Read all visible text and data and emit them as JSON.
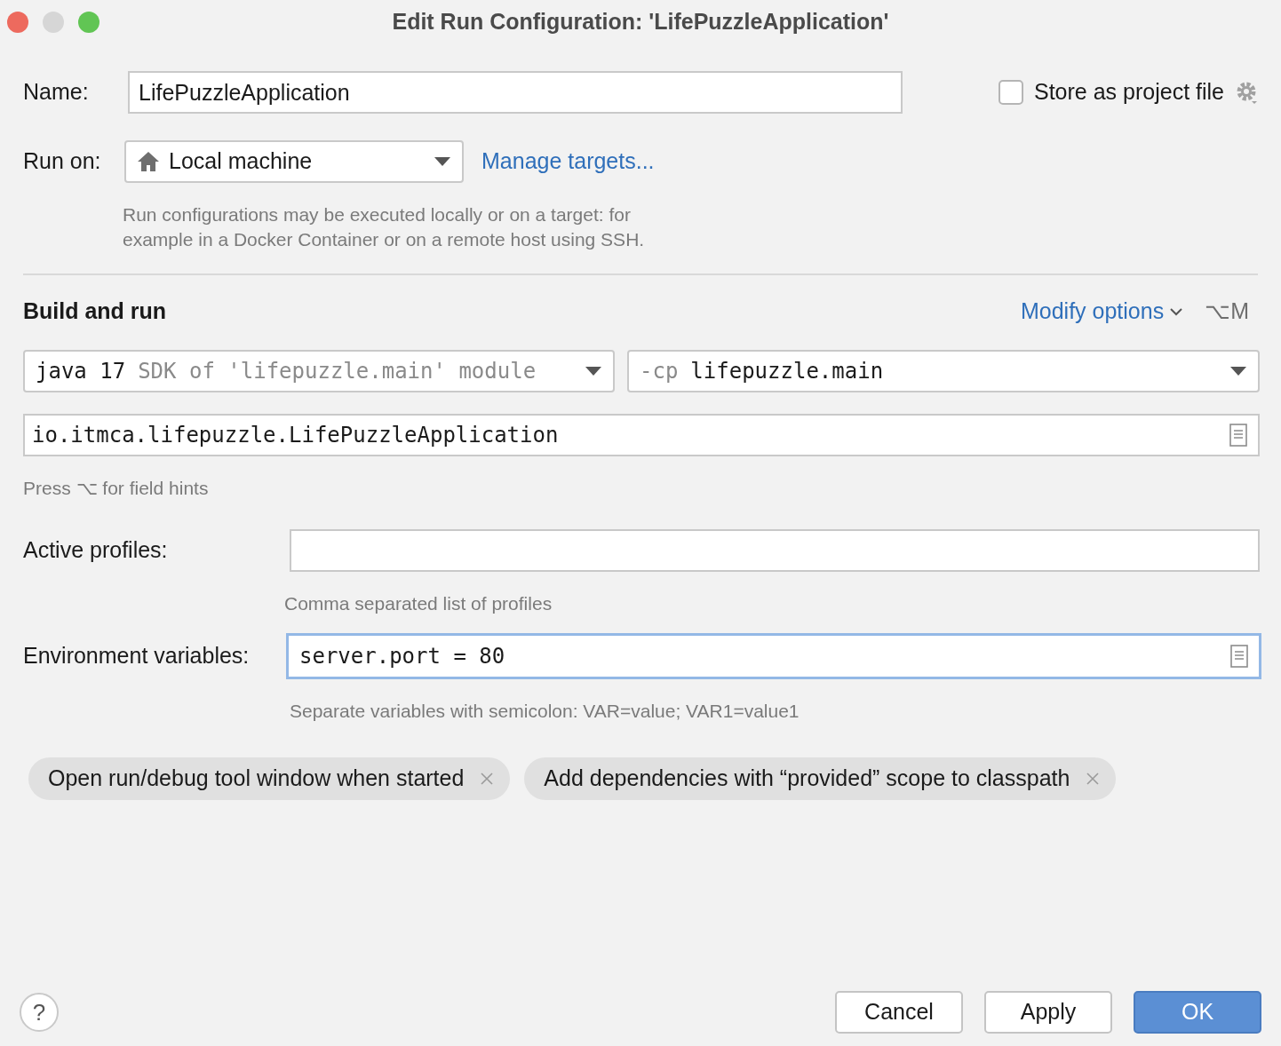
{
  "window": {
    "title": "Edit Run Configuration: 'LifePuzzleApplication'"
  },
  "name_field": {
    "label": "Name:",
    "value": "LifePuzzleApplication"
  },
  "store_as_project_file": {
    "label": "Store as project file",
    "checked": false
  },
  "run_on": {
    "label": "Run on:",
    "value": "Local machine",
    "link": "Manage targets...",
    "hint": [
      "Run configurations may be executed locally or on a target: for",
      "example in a Docker Container or on a remote host using SSH."
    ]
  },
  "section": {
    "title": "Build and run",
    "modify_options": "Modify options",
    "shortcut": "⌥M"
  },
  "jre": {
    "version": "java 17",
    "detail": "SDK of 'lifepuzzle.main' module"
  },
  "classpath": {
    "flag": "-cp",
    "module": "lifepuzzle.main"
  },
  "main_class": {
    "value": "io.itmca.lifepuzzle.LifePuzzleApplication",
    "hint": "Press ⌥ for field hints"
  },
  "fields": [
    {
      "label": "Active profiles:",
      "focused": false,
      "hint": "Comma separated list of profiles"
    },
    {
      "label": "Environment variables:",
      "value": "server.port = 80",
      "focused": true,
      "hint": "Separate variables with semicolon: VAR=value; VAR1=value1"
    }
  ],
  "options": [
    "Open run/debug tool window when started",
    "Add dependencies with “provided” scope to classpath"
  ],
  "buttons": [
    {
      "label": "Cancel",
      "kind": "normal"
    },
    {
      "label": "Apply",
      "kind": "normal"
    },
    {
      "label": "OK",
      "kind": "default"
    }
  ],
  "help": "?"
}
